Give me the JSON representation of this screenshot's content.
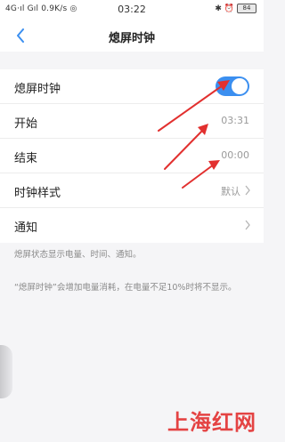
{
  "status_bar": {
    "left": "4G·ıl Gıl 0.9K/s ◎",
    "time": "03:22",
    "right_icons": "✱ ⏰",
    "battery": "84"
  },
  "nav": {
    "title": "熄屏时钟"
  },
  "settings": {
    "items": [
      {
        "label": "熄屏时钟",
        "toggle_on": true
      },
      {
        "label": "开始",
        "value": "03:31"
      },
      {
        "label": "结束",
        "value": "00:00"
      },
      {
        "label": "时钟样式",
        "value": "默认"
      },
      {
        "label": "通知",
        "value": ""
      }
    ]
  },
  "descriptions": {
    "d1": "熄屏状态显示电量、时间、通知。",
    "d2": "“熄屏时钟”会增加电量消耗，在电量不足10%时将不显示。"
  },
  "watermark": "上海红网",
  "colors": {
    "toggle_on": "#3b8ff0",
    "annotation_arrow": "#e2302f"
  }
}
